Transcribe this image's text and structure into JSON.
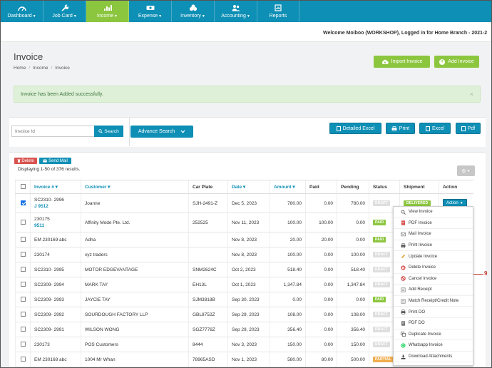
{
  "nav": {
    "items": [
      {
        "label": "Dashboard",
        "icon": "dashboard-icon"
      },
      {
        "label": "Job Card",
        "icon": "wrench-icon"
      },
      {
        "label": "Income",
        "icon": "chart-icon"
      },
      {
        "label": "Expense",
        "icon": "money-icon"
      },
      {
        "label": "Inventory",
        "icon": "boxes-icon"
      },
      {
        "label": "Accounting",
        "icon": "people-icon"
      },
      {
        "label": "Reports",
        "icon": "report-icon"
      }
    ],
    "active_index": 2,
    "active_color": "#8cc63f",
    "bar_color": "#0e8fb5"
  },
  "welcome_text": "Welcome Moiboo (WORKSHOP), Logged in for Home Branch - 2021-2",
  "page": {
    "title": "Invoice",
    "breadcrumb": [
      "Home",
      "Income",
      "Invoice"
    ],
    "import_label": "Import Invoice",
    "add_label": "Add Invoice"
  },
  "alert": {
    "message": "Invoice has been Added successfully.",
    "close": "×"
  },
  "search": {
    "placeholder": "Invoice Id",
    "search_label": "Search",
    "advanced_label": "Advance Search"
  },
  "exports": {
    "detailed_excel": "Detailed Excel",
    "print": "Print",
    "excel": "Excel",
    "pdf": "Pdf"
  },
  "list": {
    "delete_label": "Delete",
    "send_mail_label": "Send Mail",
    "summary": "Displaying 1-50 of 376 results.",
    "columns": [
      "Invoice #",
      "Customer",
      "Car Plate",
      "Date",
      "Amount",
      "Paid",
      "Pending",
      "Status",
      "Shipment",
      "Action"
    ],
    "action_label": "Action",
    "rows": [
      {
        "invoice": "SC2310- 2996",
        "sub": "J 9512",
        "customer": "Joanne",
        "plate": "SJH-2491-Z",
        "date": "Dec 5, 2023",
        "amount": "780.00",
        "paid": "0.00",
        "pending": "780.00",
        "status": "DRAFT",
        "shipment": "DELIVERED",
        "checked": true
      },
      {
        "invoice": "230175",
        "sub": "9511",
        "customer": "Affinity Mode Pte. Ltd.",
        "plate": "252525",
        "date": "Nov 11, 2023",
        "amount": "100.00",
        "paid": "100.00",
        "pending": "0.00",
        "status": "PAID",
        "shipment": "",
        "checked": false
      },
      {
        "invoice": "EM 230169 abc",
        "sub": "",
        "customer": "Adha",
        "plate": "",
        "date": "Nov 8, 2023",
        "amount": "20.00",
        "paid": "20.00",
        "pending": "0.00",
        "status": "PAID",
        "shipment": "",
        "checked": false
      },
      {
        "invoice": "230174",
        "sub": "",
        "customer": "xyz traders",
        "plate": "",
        "date": "Nov 8, 2023",
        "amount": "100.00",
        "paid": "0.00",
        "pending": "100.00",
        "status": "DRAFT",
        "shipment": "",
        "checked": false
      },
      {
        "invoice": "SC2310- 2995",
        "sub": "",
        "customer": "MOTOR EDGEVANTAGE",
        "plate": "SNM2624C",
        "date": "Oct 2, 2023",
        "amount": "518.40",
        "paid": "0.00",
        "pending": "518.40",
        "status": "DRAFT",
        "shipment": "",
        "checked": false
      },
      {
        "invoice": "SC2309- 2994",
        "sub": "",
        "customer": "MARK TAY",
        "plate": "EH13L",
        "date": "Oct 1, 2023",
        "amount": "1,347.84",
        "paid": "0.00",
        "pending": "1,347.84",
        "status": "DRAFT",
        "shipment": "",
        "checked": false
      },
      {
        "invoice": "SC2309- 2993",
        "sub": "",
        "customer": "JAYCIE TAY",
        "plate": "SJM3818B",
        "date": "Sep 30, 2023",
        "amount": "0.00",
        "paid": "0.00",
        "pending": "0.00",
        "status": "PAID",
        "shipment": "",
        "checked": false
      },
      {
        "invoice": "SC2309- 2992",
        "sub": "",
        "customer": "SOURDOUGH FACTORY LLP",
        "plate": "GBL8752Z",
        "date": "Sep 29, 2023",
        "amount": "108.00",
        "paid": "0.00",
        "pending": "108.00",
        "status": "DRAFT",
        "shipment": "",
        "checked": false
      },
      {
        "invoice": "SC2309- 2991",
        "sub": "",
        "customer": "WILSON WONG",
        "plate": "SGZ7778Z",
        "date": "Sep 29, 2023",
        "amount": "356.40",
        "paid": "0.00",
        "pending": "356.40",
        "status": "DRAFT",
        "shipment": "",
        "checked": false
      },
      {
        "invoice": "230173",
        "sub": "",
        "customer": "POS Customers",
        "plate": "8444",
        "date": "Nov 3, 2023",
        "amount": "150.00",
        "paid": "0.00",
        "pending": "150.00",
        "status": "DRAFT",
        "shipment": "",
        "checked": false
      },
      {
        "invoice": "EM 230168 abc",
        "sub": "",
        "customer": "1004 Mr Whan",
        "plate": "78965ASD",
        "date": "Nov 1, 2023",
        "amount": "580.00",
        "paid": "80.00",
        "pending": "500.00",
        "status": "PARTIAL",
        "shipment": "",
        "checked": false
      }
    ]
  },
  "action_menu": [
    {
      "label": "View Invoice",
      "icon": "magnifier-icon",
      "color": "#666"
    },
    {
      "label": "PDF Invoice",
      "icon": "pdf-icon",
      "color": "#d9534f"
    },
    {
      "label": "Mail Invoice",
      "icon": "mail-icon",
      "color": "#888"
    },
    {
      "label": "Print Invoice",
      "icon": "printer-icon",
      "color": "#555"
    },
    {
      "label": "Update Invoice",
      "icon": "pencil-icon",
      "color": "#e0a030"
    },
    {
      "label": "Delete Invoice",
      "icon": "delete-icon",
      "color": "#d9534f"
    },
    {
      "label": "Cancel Invoice",
      "icon": "cancel-icon",
      "color": "#c9302c"
    },
    {
      "label": "Add Receipt",
      "icon": "receipt-icon",
      "color": "#777"
    },
    {
      "label": "Match Receipt/Credit Note",
      "icon": "match-icon",
      "color": "#777"
    },
    {
      "label": "Print DO",
      "icon": "printer-icon",
      "color": "#555"
    },
    {
      "label": "PDF DO",
      "icon": "pdf-icon",
      "color": "#777"
    },
    {
      "label": "Duplicate Invoice",
      "icon": "duplicate-icon",
      "color": "#555"
    },
    {
      "label": "Whatsapp Invoice",
      "icon": "whatsapp-icon",
      "color": "#25d366"
    },
    {
      "label": "Download Attachments",
      "icon": "download-icon",
      "color": "#444"
    }
  ],
  "callout": {
    "number": "9",
    "color": "#c0392b"
  }
}
